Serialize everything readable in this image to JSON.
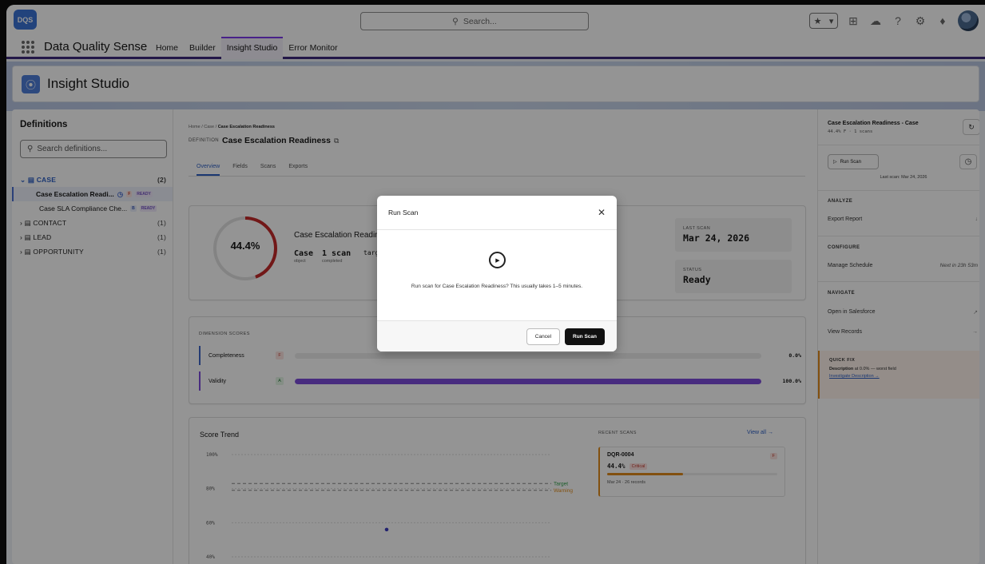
{
  "header": {
    "logo_text": "DQS",
    "search_placeholder": "Search...",
    "icons": [
      "favorites-star-icon",
      "chevron-down-icon",
      "add-icon",
      "trailhead-icon",
      "help-icon",
      "setup-gear-icon",
      "bell-icon",
      "avatar"
    ]
  },
  "nav": {
    "app_name": "Data Quality Sense",
    "items": [
      {
        "label": "Home",
        "active": false
      },
      {
        "label": "Builder",
        "active": false
      },
      {
        "label": "Insight Studio",
        "active": true
      },
      {
        "label": "Error Monitor",
        "active": false
      }
    ]
  },
  "page_header": {
    "title": "Insight Studio"
  },
  "left": {
    "title": "Definitions",
    "search_placeholder": "Search definitions...",
    "tree": [
      {
        "label": "CASE",
        "count": "(2)"
      },
      {
        "label": "Case Escalation Readi...",
        "grade": "F",
        "status": "READY"
      },
      {
        "label": "Case SLA Compliance Che...",
        "grade": "B",
        "status": "READY"
      },
      {
        "label": "CONTACT",
        "count": "(1)"
      },
      {
        "label": "LEAD",
        "count": "(1)"
      },
      {
        "label": "OPPORTUNITY",
        "count": "(1)"
      }
    ]
  },
  "center": {
    "breadcrumb": [
      "Home",
      "Case",
      "Case Escalation Readiness"
    ],
    "def_label": "DEFINITION",
    "def_title": "Case Escalation Readiness",
    "tabs": [
      "Overview",
      "Fields",
      "Scans",
      "Exports"
    ],
    "summary": {
      "score": "44.4%",
      "score_value": 44.4,
      "title": "Case Escalation Readiness",
      "object_value": "Case",
      "object_label": "object",
      "scans_value": "1 scan",
      "scans_label": "completed",
      "target_value": "target:",
      "last_scan_label": "LAST SCAN",
      "last_scan_value": "Mar 24, 2026",
      "status_label": "STATUS",
      "status_value": "Ready"
    },
    "dimensions": {
      "title": "DIMENSION SCORES",
      "rows": [
        {
          "name": "Completeness",
          "grade": "F",
          "value": 0.0,
          "pct": "0.0%"
        },
        {
          "name": "Validity",
          "grade": "A",
          "value": 100.0,
          "pct": "100.0%"
        }
      ]
    },
    "trend": {
      "title": "Score Trend",
      "y_ticks": [
        "100%",
        "80%",
        "60%",
        "40%"
      ],
      "target_label": "Target",
      "warning_label": "Warning",
      "recent_title": "RECENT SCANS",
      "view_all": "View all →",
      "recent": {
        "id": "DQR-0004",
        "grade": "F",
        "pct": "44.4%",
        "badge": "Critical",
        "value": 44.4,
        "meta": "Mar 24 · 26 records"
      }
    }
  },
  "chart_data": {
    "type": "scatter",
    "title": "Score Trend",
    "xlabel": "",
    "ylabel": "",
    "ylim": [
      40,
      100
    ],
    "y_ticks": [
      "100%",
      "80%",
      "60%",
      "40%"
    ],
    "series": [
      {
        "name": "",
        "values": [
          {
            "x": 1,
            "y": 56
          }
        ]
      }
    ],
    "reference_lines": [
      {
        "name": "Target",
        "y": 83
      },
      {
        "name": "Warning",
        "y": 79
      }
    ],
    "grid": true
  },
  "right": {
    "title": "Case Escalation Readiness - Case",
    "subtitle": "44.4% F · 1 scans",
    "run_scan": "Run Scan",
    "last_scan": "Last scan: Mar 24, 2026",
    "analyze": "ANALYZE",
    "export_report": "Export Report",
    "configure": "CONFIGURE",
    "manage_schedule": "Manage Schedule",
    "next_run": "Next in 23h 53m",
    "navigate": "NAVIGATE",
    "open_salesforce": "Open in Salesforce",
    "view_records": "View Records",
    "quick_fix": {
      "title": "QUICK FIX",
      "field": "Description",
      "detail": "at 0.0% — worst field",
      "link": "Investigate Description →"
    }
  },
  "modal": {
    "title": "Run Scan",
    "message": "Run scan for Case Escalation Readiness? This usually takes 1–5 minutes.",
    "cancel": "Cancel",
    "confirm": "Run Scan"
  }
}
